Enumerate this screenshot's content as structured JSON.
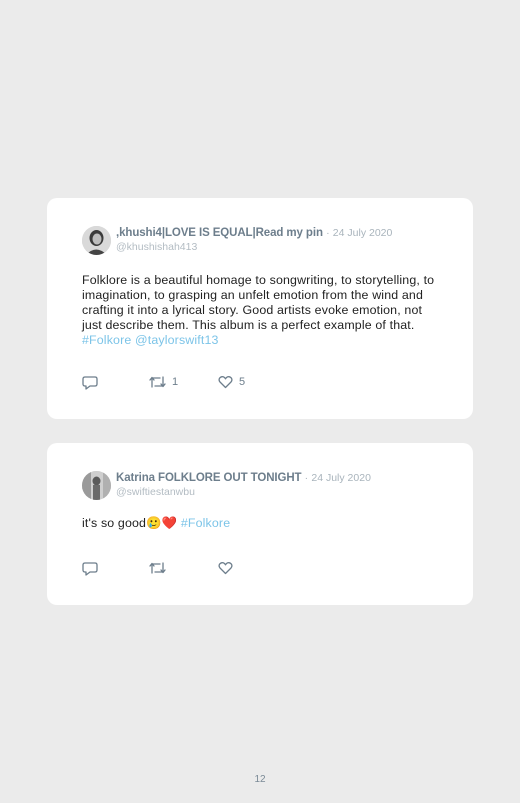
{
  "tweets": [
    {
      "user_name": ",khushi4|LOVE IS EQUAL|Read my pin",
      "separator": "·",
      "date": "24 July 2020",
      "handle": "@khushishah413",
      "text": "Folklore is a beautiful homage to songwriting, to storytelling, to imagination, to grasping an unfelt emotion from the wind and crafting it into a lyrical story. Good artists evoke emotion, not just describe them. This album is a perfect example of that.",
      "hashtag": "#Folkore",
      "mention": "@taylorswift13",
      "retweet_count": "1",
      "like_count": "5"
    },
    {
      "user_name": "Katrina FOLKLORE OUT TONIGHT",
      "separator": "·",
      "date": "24 July 2020",
      "handle": "@swiftiestanwbu",
      "text": "it's so good",
      "emoji": "🥲❤️",
      "hashtag": "#Folkore",
      "retweet_count": "",
      "like_count": ""
    }
  ],
  "page_number": "12",
  "colors": {
    "background": "#ebebeb",
    "card": "#ffffff",
    "link": "#7cc4e8",
    "name": "#6d7e8c",
    "muted": "#b3bcc3",
    "icon": "#6d7e8c"
  },
  "icons": [
    "reply-icon",
    "retweet-icon",
    "like-icon"
  ]
}
